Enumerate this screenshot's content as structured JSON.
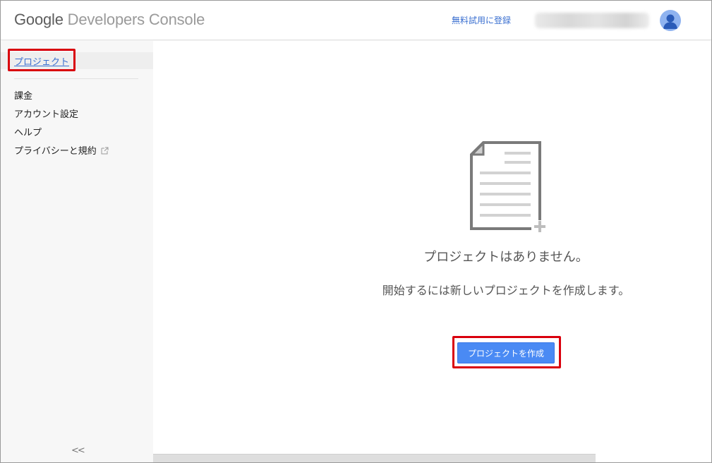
{
  "header": {
    "brand_google": "Google",
    "brand_rest": " Developers Console",
    "trial_link": "無料試用に登録"
  },
  "sidebar": {
    "projects": "プロジェクト",
    "items": [
      {
        "label": "課金"
      },
      {
        "label": "アカウント設定"
      },
      {
        "label": "ヘルプ"
      },
      {
        "label": "プライバシーと規約"
      }
    ],
    "collapse_label": "<<"
  },
  "main": {
    "empty_title": "プロジェクトはありません。",
    "empty_desc": "開始するには新しいプロジェクトを作成します。",
    "create_button": "プロジェクトを作成"
  },
  "icons": {
    "document": "new-document-icon",
    "external": "external-link-icon",
    "avatar": "user-avatar-icon"
  },
  "colors": {
    "link": "#3a6fd0",
    "primary_button": "#4a8af4",
    "highlight_box": "#d9000d"
  }
}
